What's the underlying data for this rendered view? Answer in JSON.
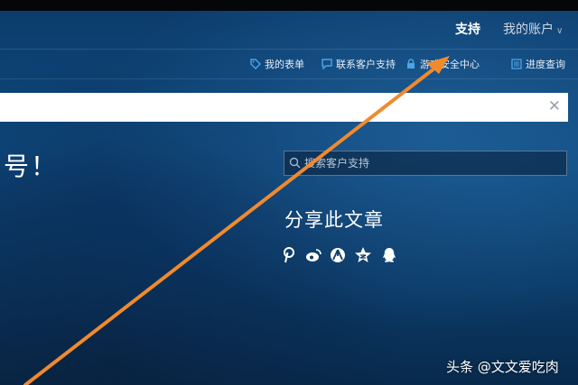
{
  "topnav": {
    "support_label": "支持",
    "account_label": "我的账户"
  },
  "subnav": [
    {
      "label": "我的表单",
      "icon": "tag-icon"
    },
    {
      "label": "联系客户支持",
      "icon": "chat-icon"
    },
    {
      "label": "游戏安全中心",
      "icon": "lock-icon"
    },
    {
      "label": "进度查询",
      "icon": "list-icon"
    }
  ],
  "headline": "号！",
  "support_search": {
    "placeholder": "搜索客户支持"
  },
  "share": {
    "title": "分享此文章",
    "icons": [
      "pinterest-icon",
      "weibo-icon",
      "tencent-icon",
      "qzone-icon",
      "qq-icon"
    ]
  },
  "watermark": "头条 @文文爱吃肉",
  "colors": {
    "accent_arrow": "#f08a2e",
    "background": "#0d3a66"
  }
}
